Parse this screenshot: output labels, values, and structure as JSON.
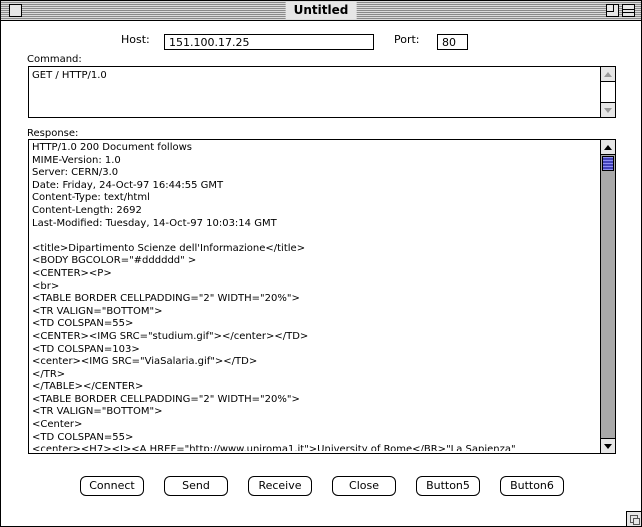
{
  "window": {
    "title": "Untitled"
  },
  "host": {
    "label": "Host:",
    "value": "151.100.17.25"
  },
  "port": {
    "label": "Port:",
    "value": "80"
  },
  "command": {
    "label": "Command:",
    "value": "GET / HTTP/1.0"
  },
  "response": {
    "label": "Response:",
    "lines": [
      "HTTP/1.0 200 Document follows",
      "MIME-Version: 1.0",
      "Server: CERN/3.0",
      "Date: Friday, 24-Oct-97 16:44:55 GMT",
      "Content-Type: text/html",
      "Content-Length: 2692",
      "Last-Modified: Tuesday, 14-Oct-97 10:03:14 GMT",
      "",
      "<title>Dipartimento Scienze dell'Informazione</title>",
      "<BODY BGCOLOR=\"#dddddd\" >",
      "<CENTER><P>",
      "<br>",
      "<TABLE BORDER CELLPADDING=\"2\" WIDTH=\"20%\">",
      "<TR VALIGN=\"BOTTOM\">",
      "<TD COLSPAN=55>",
      "<CENTER><IMG SRC=\"studium.gif\"></center></TD>",
      "<TD COLSPAN=103>",
      "<center><IMG SRC=\"ViaSalaria.gif\"></TD>",
      "</TR>",
      "</TABLE></CENTER>",
      "<TABLE BORDER CELLPADDING=\"2\" WIDTH=\"20%\">",
      "<TR VALIGN=\"BOTTOM\">",
      "<Center>",
      "<TD COLSPAN=55>",
      "<center><H7><I><A HREF=\"http://www.uniroma1.it\">University of Rome</BR>\"La Sapienza\""
    ]
  },
  "buttons": {
    "connect": "Connect",
    "send": "Send",
    "receive": "Receive",
    "close": "Close",
    "button5": "Button5",
    "button6": "Button6"
  },
  "colors": {
    "scroll_thumb": "#5b5bd6",
    "scroll_track": "#a9a9a9"
  }
}
